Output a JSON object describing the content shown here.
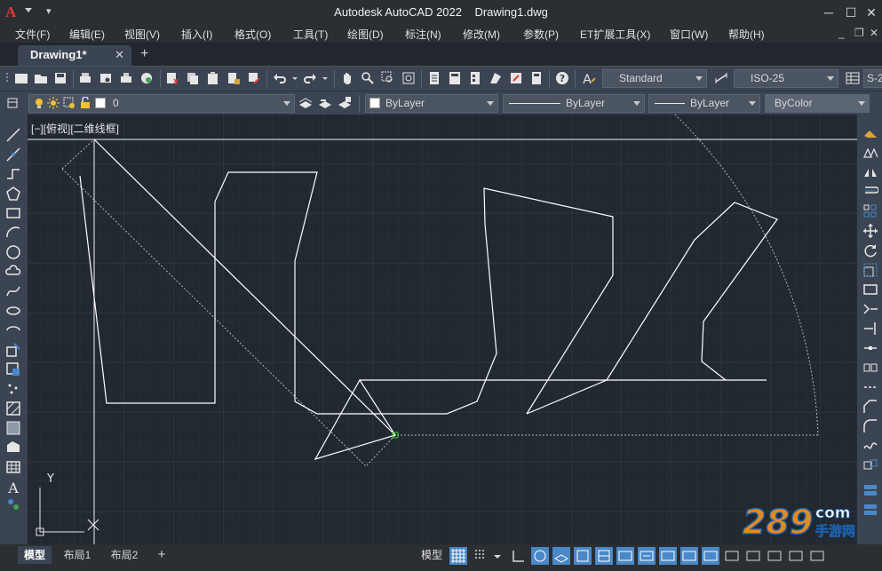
{
  "title": {
    "app_logo": "A",
    "text": "Autodesk AutoCAD 2022    Drawing1.dwg",
    "minimize": "─",
    "maximize": "☐",
    "close": "✕"
  },
  "menu": [
    "文件(F)",
    "编辑(E)",
    "视图(V)",
    "插入(I)",
    "格式(O)",
    "工具(T)",
    "绘图(D)",
    "标注(N)",
    "修改(M)",
    "参数(P)",
    "ET扩展工具(X)",
    "窗口(W)",
    "帮助(H)"
  ],
  "mdi_controls": {
    "minimize": "_",
    "restore": "❐",
    "close": "✕"
  },
  "tabs": {
    "doc": "Drawing1*",
    "close": "✕",
    "new": "+"
  },
  "toolbar1": {
    "text_style": "Standard",
    "dim_style": "ISO-25",
    "truncated_style": "S-2"
  },
  "toolbar2": {
    "layer": "0",
    "color": "ByLayer",
    "linetype": "ByLayer",
    "lineweight": "ByLayer",
    "plot_style": "ByColor"
  },
  "viewport": {
    "label": "[−][俯视][二维线框]",
    "ucs_y": "Y",
    "background": "#212830",
    "line_color": "#ffffff"
  },
  "status": {
    "tabs": [
      "模型",
      "布局1",
      "布局2"
    ],
    "add": "+",
    "model": "模型"
  },
  "watermark": {
    "number": "289",
    "suffix": "com",
    "caption": "手游网"
  },
  "colors": {
    "accent": "#e23b32",
    "toolbar": "#3b4452",
    "titlebar": "#2b2e33",
    "status_active": "#4a88c7"
  }
}
